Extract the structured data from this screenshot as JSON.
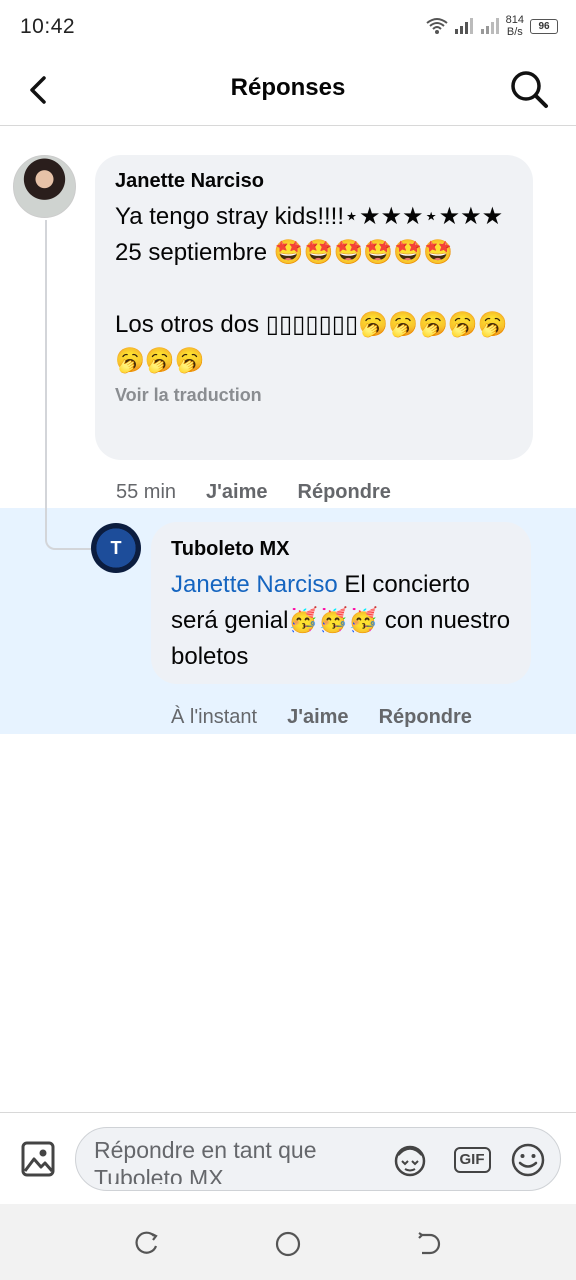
{
  "status_bar": {
    "time": "10:42",
    "net_speed_value": "814",
    "net_speed_unit": "B/s",
    "battery": "96"
  },
  "header": {
    "title": "Réponses"
  },
  "comments": [
    {
      "author": "Janette Narciso",
      "text": "Ya tengo stray kids!!!!⋆★★★⋆★★★\n25 septiembre 🤩🤩🤩🤩🤩🤩\n\nLos otros dos ▯▯▯▯▯▯▯🥱🥱🥱🥱🥱🥱🥱🥱",
      "translate": "Voir la traduction",
      "time": "55 min",
      "like": "J'aime",
      "reply": "Répondre"
    },
    {
      "author": "Tuboleto MX",
      "mention": "Janette Narciso",
      "text": " El concierto será genial🥳🥳🥳 con nuestro boletos",
      "time": "À l'instant",
      "like": "J'aime",
      "reply": "Répondre",
      "avatar_label": "T"
    }
  ],
  "compose": {
    "placeholder": "Répondre en tant que Tuboleto MX",
    "gif_label": "GIF"
  },
  "colors": {
    "accent": "#1565c0",
    "bubble": "#f0f2f5",
    "highlight": "#e7f3ff"
  }
}
